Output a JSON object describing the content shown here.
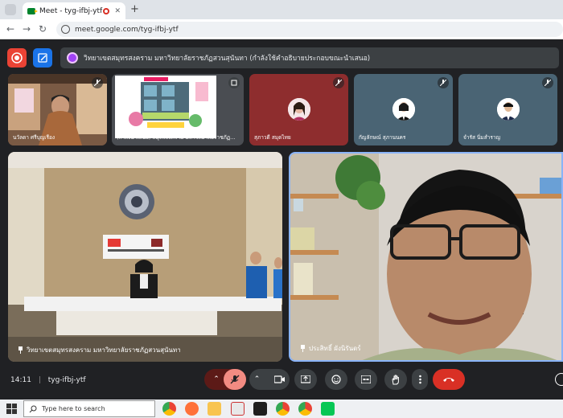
{
  "browser": {
    "tab_title": "Meet - tyg-ifbj-ytf",
    "tab_close": "✕",
    "new_tab": "+",
    "url": "meet.google.com/tyg-ifbj-ytf"
  },
  "meeting": {
    "title": "วิทยาเขตสมุทรสงคราม มหาวิทยาลัยราชภัฏสวนสุนันทา (กำลังใช้คำอธิบายประกอบขณะนำเสนอ)",
    "time": "14:11",
    "code": "tyg-ifbj-ytf",
    "divider": "|"
  },
  "participants": [
    {
      "name": "นวัลดา ศรีบุญเรือง",
      "muted": true
    },
    {
      "name": "(กำลังนำเสนอ) สมุทรสงคราม มหาวิทยาลัยราชภัฏสวนสุนันทา",
      "muted": false
    },
    {
      "name": "สุภาวดี สมุดไทย",
      "muted": true
    },
    {
      "name": "กัญลักษณ์ สุภานนคร",
      "muted": true
    },
    {
      "name": "จำรัส นิ่มสำราญ",
      "muted": true
    }
  ],
  "main_tiles": [
    {
      "name": "วิทยาเขตสมุทรสงคราม มหาวิทยาลัยราชภัฏสวนสุนันทา"
    },
    {
      "name": "ประสิทธิ์ ผังนิรันดร์"
    }
  ],
  "icons": {
    "record": "record-icon",
    "annotate": "annotate-icon",
    "mic_off": "mic-off-icon",
    "camera": "camera-icon",
    "present": "present-icon",
    "emoji": "emoji-icon",
    "captions": "captions-icon",
    "hand": "raise-hand-icon",
    "more": "more-icon",
    "end_call": "end-call-icon"
  },
  "colors": {
    "end_call": "#d93025",
    "mic_off_active": "#f28b82",
    "record": "#ea4335",
    "accent": "#1a73e8"
  },
  "taskbar": {
    "search_placeholder": "Type here to search"
  }
}
